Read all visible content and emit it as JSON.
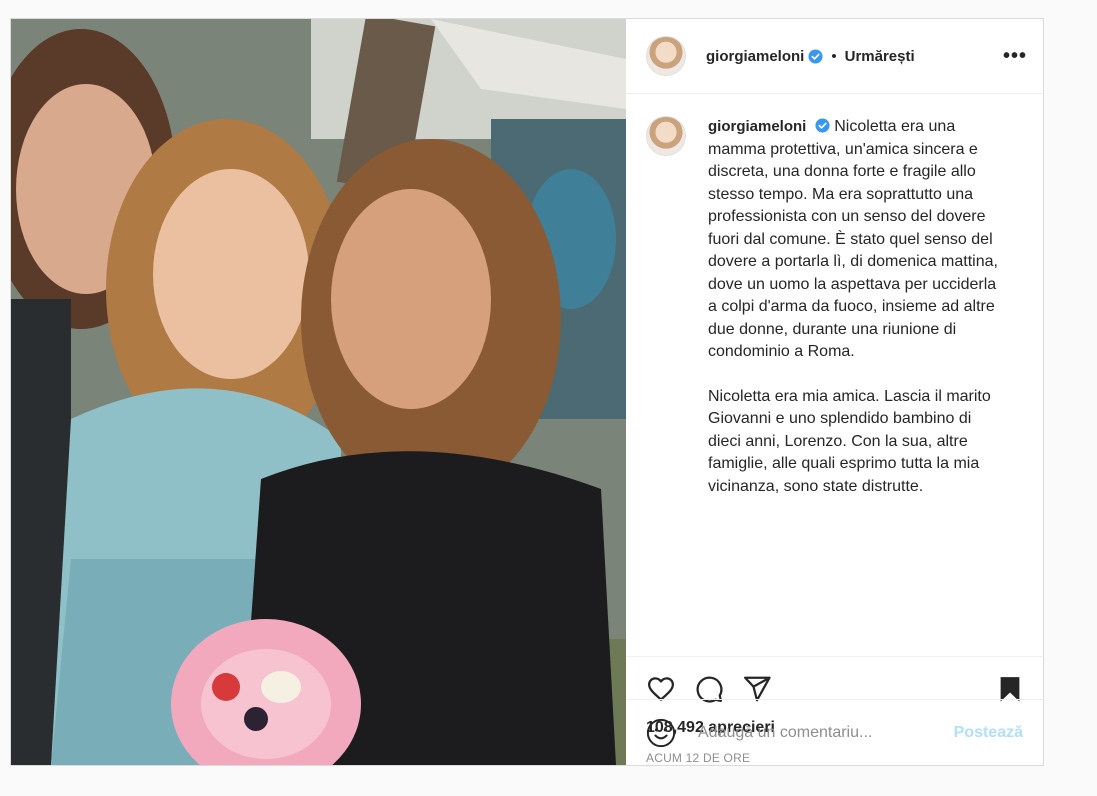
{
  "post": {
    "username": "giorgiameloni",
    "follow_label": "Urmărești",
    "dot": "•",
    "more_label": "•••",
    "caption_p1": "Nicoletta era una mamma protettiva, un'amica sincera e discreta, una donna forte e fragile allo stesso tempo. Ma era soprattutto una professionista con un senso del dovere fuori dal comune. È stato quel senso del dovere a portarla lì, di domenica mattina, dove un uomo la aspettava per ucciderla a colpi d'arma da fuoco, insieme ad altre due donne, durante una riunione di condominio a Roma.",
    "caption_p2": "Nicoletta era mia amica. Lascia il marito Giovanni e uno splendido bambino di dieci anni, Lorenzo. Con la sua, altre famiglie, alle quali esprimo tutta la mia vicinanza, sono state distrutte.",
    "likes": "108,492 aprecieri",
    "timestamp": "ACUM 12 DE ORE",
    "comment_placeholder": "Adaugă un comentariu...",
    "post_button": "Postează"
  },
  "icons": {
    "verified": "verified-badge-icon",
    "like": "heart-icon",
    "comment": "comment-bubble-icon",
    "share": "paper-plane-icon",
    "save": "bookmark-icon",
    "emoji": "emoji-smile-icon"
  },
  "colors": {
    "verified_blue": "#3897f0",
    "post_button_disabled": "#b2dffc",
    "text": "#262626",
    "muted": "#8e8e8e"
  }
}
